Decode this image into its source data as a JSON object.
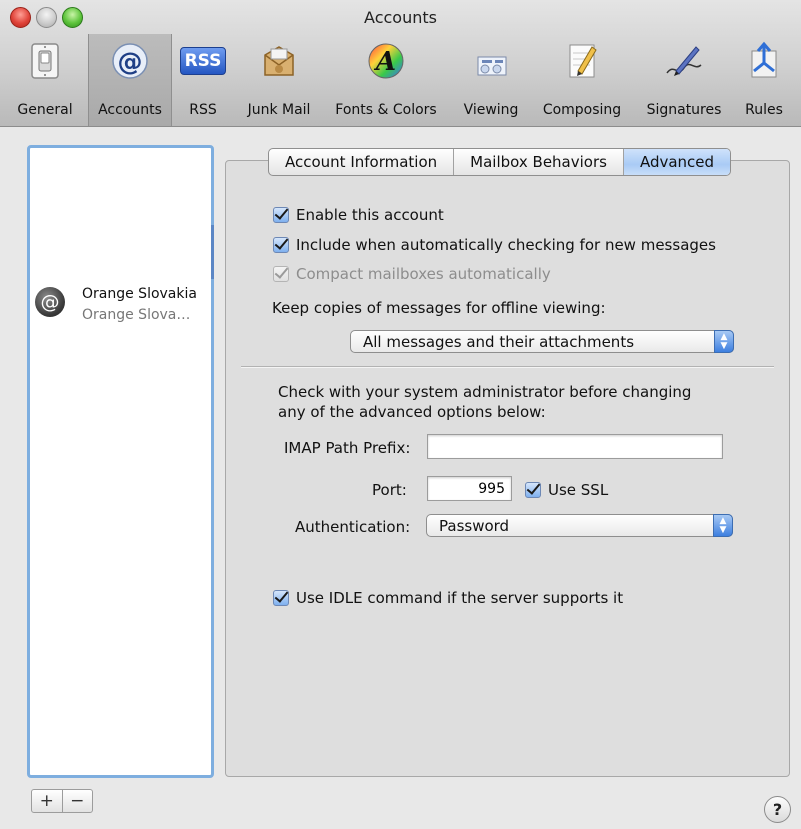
{
  "window": {
    "title": "Accounts"
  },
  "toolbar": {
    "items": [
      {
        "label": "General",
        "icon": "light-switch-icon"
      },
      {
        "label": "Accounts",
        "icon": "at-sign-icon"
      },
      {
        "label": "RSS",
        "icon": "rss-icon"
      },
      {
        "label": "Junk Mail",
        "icon": "junk-mail-icon"
      },
      {
        "label": "Fonts & Colors",
        "icon": "fonts-colors-icon"
      },
      {
        "label": "Viewing",
        "icon": "viewing-icon"
      },
      {
        "label": "Composing",
        "icon": "composing-icon"
      },
      {
        "label": "Signatures",
        "icon": "signature-icon"
      },
      {
        "label": "Rules",
        "icon": "rules-icon"
      }
    ],
    "selected": "Accounts",
    "rss_badge": "RSS"
  },
  "accounts": {
    "items": [
      {
        "name": "Orange Slovakia",
        "subtitle": "Orange Slova…",
        "icon": "at-sign-icon"
      }
    ],
    "add_label": "+",
    "remove_label": "−"
  },
  "tabs": {
    "items": [
      "Account Information",
      "Mailbox Behaviors",
      "Advanced"
    ],
    "active": "Advanced"
  },
  "advanced": {
    "enable_account": {
      "label": "Enable this account",
      "checked": true
    },
    "include_checking": {
      "label": "Include when automatically checking for new messages",
      "checked": true
    },
    "compact_mailboxes": {
      "label": "Compact mailboxes automatically",
      "checked": true,
      "disabled": true
    },
    "keep_copies_label": "Keep copies of messages for offline viewing:",
    "keep_copies_value": "All messages and their attachments",
    "note_line1": "Check with your system administrator before changing",
    "note_line2": "any of the advanced options below:",
    "imap_prefix_label": "IMAP Path Prefix:",
    "imap_prefix_value": "",
    "port_label": "Port:",
    "port_value": "995",
    "use_ssl": {
      "label": "Use SSL",
      "checked": true
    },
    "auth_label": "Authentication:",
    "auth_value": "Password",
    "use_idle": {
      "label": "Use IDLE command if the server supports it",
      "checked": true
    }
  },
  "help": {
    "label": "?"
  },
  "colors": {
    "selection_blue": "#7eaedf",
    "popup_arrow_blue": "#3d7fe0",
    "close_red": "#e0443a",
    "zoom_green": "#5ec43c"
  }
}
